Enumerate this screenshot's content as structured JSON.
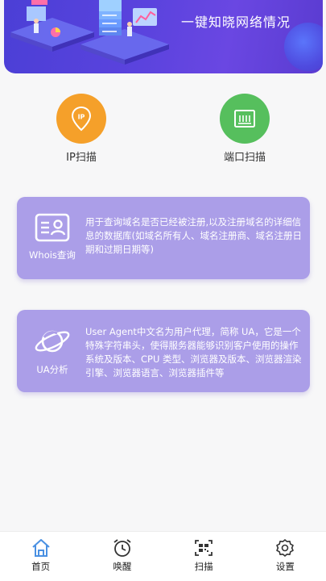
{
  "banner": {
    "tagline": "一键知晓网络情况"
  },
  "quick_actions": [
    {
      "label": "IP扫描",
      "icon": "ip-location-pin-icon",
      "color": "#f5a02a"
    },
    {
      "label": "端口扫描",
      "icon": "ethernet-port-icon",
      "color": "#56bf5d"
    }
  ],
  "cards": [
    {
      "title": "Whois查询",
      "icon": "id-card-icon",
      "description": "用于查询域名是否已经被注册,以及注册域名的详细信息的数据库(如域名所有人、域名注册商、域名注册日期和过期日期等)"
    },
    {
      "title": "UA分析",
      "icon": "planet-icon",
      "description": "User Agent中文名为用户代理，简称 UA，它是一个特殊字符串头，使得服务器能够识别客户使用的操作系统及版本、CPU 类型、浏览器及版本、浏览器渲染引擎、浏览器语言、浏览器插件等"
    }
  ],
  "tabbar": {
    "active": "home",
    "items": [
      {
        "id": "home",
        "label": "首页",
        "icon": "home-icon"
      },
      {
        "id": "wake",
        "label": "唤醒",
        "icon": "alarm-clock-icon"
      },
      {
        "id": "scan",
        "label": "扫描",
        "icon": "qr-scan-icon"
      },
      {
        "id": "settings",
        "label": "设置",
        "icon": "gear-icon"
      }
    ]
  },
  "colors": {
    "banner": "#5a43dc",
    "card": "#ab9ee8",
    "ip_button": "#f5a02a",
    "port_button": "#56bf5d",
    "tab_active_icon": "#4a90e2"
  }
}
